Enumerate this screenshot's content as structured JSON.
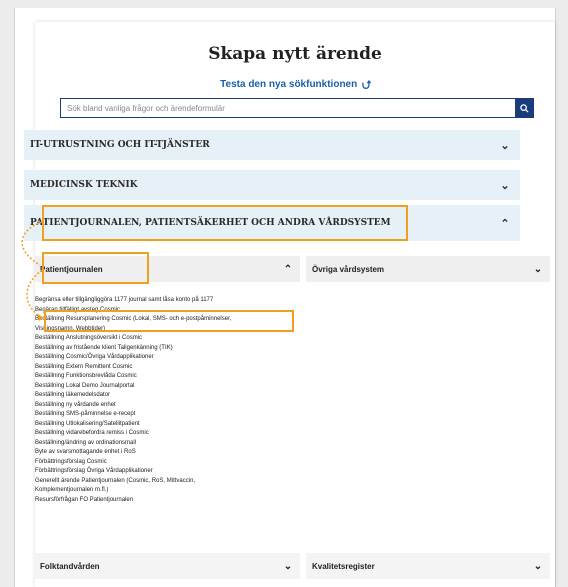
{
  "header": {
    "title": "Skapa nytt ärende",
    "subtitle": "Testa den nya sökfunktionen"
  },
  "search": {
    "placeholder": "Sök bland vanliga frågor och ärendeformulär"
  },
  "sections": [
    {
      "label": "IT-UTRUSTNING OCH IT-TJÄNSTER",
      "expanded": false
    },
    {
      "label": "MEDICINSK TEKNIK",
      "expanded": false
    },
    {
      "label": "PATIENTJOURNALEN, PATIENTSÄKERHET OCH ANDRA VÅRDSYSTEM",
      "expanded": true
    }
  ],
  "subcategories": {
    "patientjournalen": {
      "label": "Patientjournalen",
      "expanded": true
    },
    "ovriga": {
      "label": "Övriga vårdsystem",
      "expanded": false
    },
    "folktandvarden": {
      "label": "Folktandvården",
      "expanded": false
    },
    "kvalitetsregister": {
      "label": "Kvalitetsregister",
      "expanded": false
    }
  },
  "items": [
    "Begränsa eller tillgängliggöra 1177 journal samt låsa konto på 1177",
    "Begäran tillfälligt avsteg Cosmic",
    "Beställning Resursplanering Cosmic (Lokal, SMS- och e-postpåminnelser,",
    "Visningsnamn, Webbtider)",
    "Beställning Anslutningsöversikt i Cosmic",
    "Beställning av fristående klient Taligenkänning (TIK)",
    "Beställning Cosmic/Övriga Vårdapplikationer",
    "Beställning Extern Remittent Cosmic",
    "Beställning Funktionsbrevlåda Cosmic",
    "Beställning Lokal Demo Journalportal",
    "Beställning läkemedelsdator",
    "Beställning ny vårdande enhet",
    "Beställning SMS-påminnelse e-recept",
    "Beställning Utlokalisering/Satellitpatient",
    "Beställning vidarebefordra remiss i Cosmic",
    "Beställning/ändring av ordinationsmall",
    "Byte av svarsmottagande enhet i RoS",
    "Förbättringsförslag Cosmic",
    "Förbättringsförslag Övriga Vårdapplikationer",
    "Generellt ärende Patientjournalen (Cosmic, RoS, Mittvaccin,",
    "Komplementjournalen m.fl.)",
    "Resursförfrågan FO Patientjournalen"
  ],
  "colors": {
    "accent": "#1a3c7a",
    "highlight": "#f0a020",
    "section_bg": "#e6f0f7"
  },
  "icons": {
    "search": "search-icon",
    "collapse": "chevron-up-icon",
    "expand": "chevron-down-icon",
    "arrow": "curved-arrow-icon"
  }
}
